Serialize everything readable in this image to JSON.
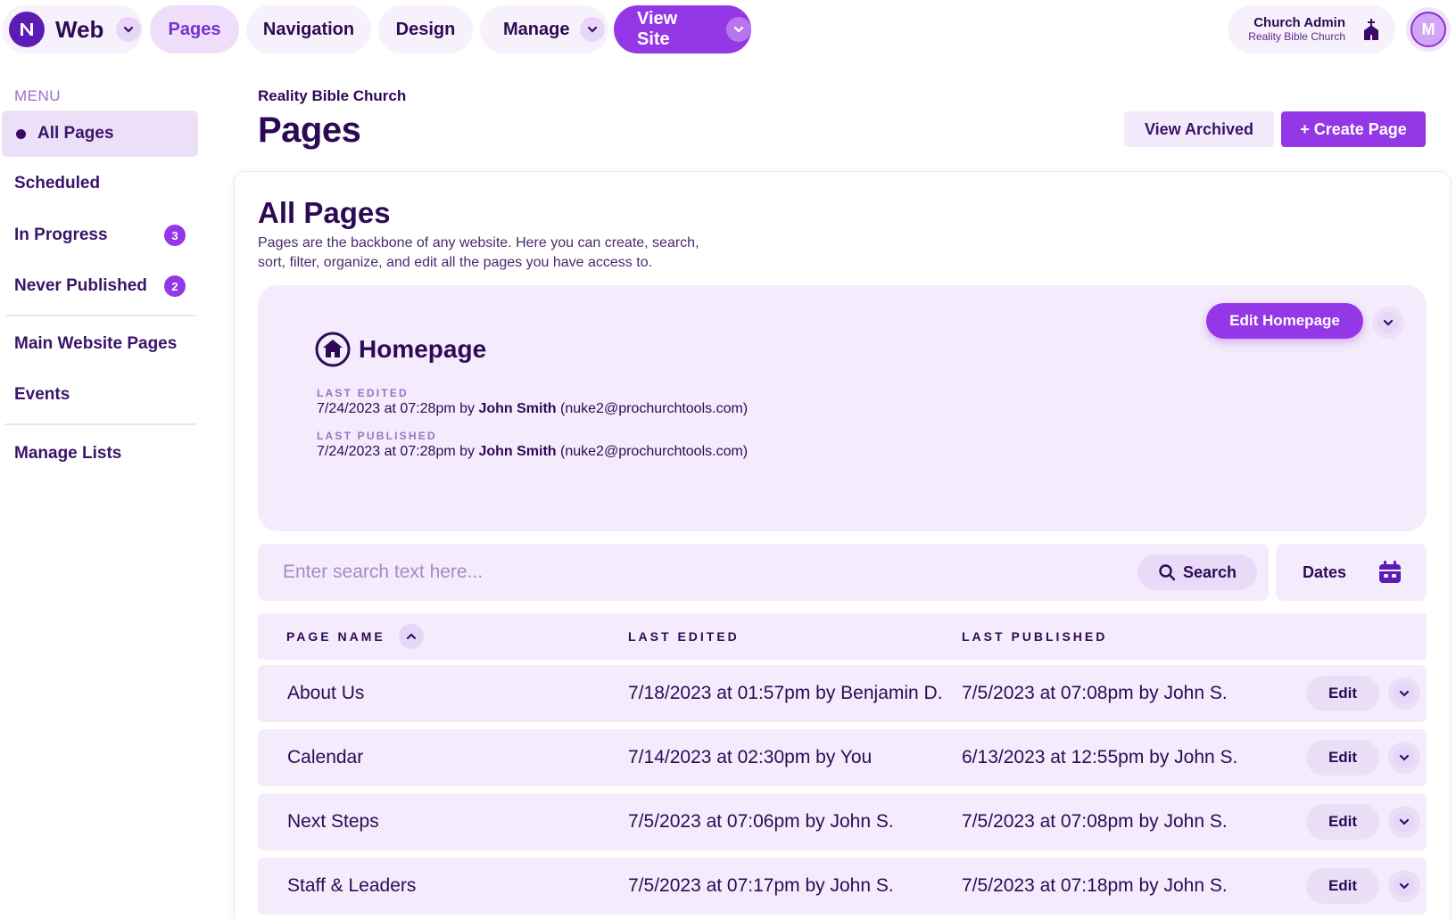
{
  "topbar": {
    "brand": "Web",
    "tabs": {
      "pages": "Pages",
      "navigation": "Navigation",
      "design": "Design",
      "manage": "Manage",
      "view_site": "View Site"
    },
    "account": {
      "name": "Church Admin",
      "org": "Reality Bible Church",
      "avatar_initial": "M"
    }
  },
  "sidebar": {
    "heading": "MENU",
    "items": {
      "all_pages": "All Pages",
      "scheduled": "Scheduled",
      "in_progress": "In Progress",
      "in_progress_count": "3",
      "never_published": "Never Published",
      "never_published_count": "2",
      "main_website_pages": "Main Website Pages",
      "events": "Events",
      "manage_lists": "Manage Lists"
    }
  },
  "header": {
    "org": "Reality Bible Church",
    "title": "Pages",
    "view_archived": "View Archived",
    "create_page": "+ Create Page"
  },
  "main": {
    "title": "All Pages",
    "description": "Pages are the backbone of any website. Here you can create, search, sort, filter, organize, and edit all the pages you have access to.",
    "homepage": {
      "title": "Homepage",
      "edit_button": "Edit Homepage",
      "last_edited_label": "LAST EDITED",
      "last_edited_prefix": "7/24/2023 at 07:28pm by ",
      "last_edited_user": "John Smith",
      "last_edited_email": " (nuke2@prochurchtools.com)",
      "last_published_label": "LAST PUBLISHED",
      "last_published_prefix": "7/24/2023 at 07:28pm by ",
      "last_published_user": "John Smith",
      "last_published_email": " (nuke2@prochurchtools.com)"
    },
    "search": {
      "placeholder": "Enter search text here...",
      "button": "Search",
      "dates": "Dates"
    },
    "table": {
      "headers": {
        "page_name": "PAGE NAME",
        "last_edited": "LAST EDITED",
        "last_published": "LAST PUBLISHED"
      },
      "edit_label": "Edit",
      "rows": [
        {
          "name": "About Us",
          "last_edited": "7/18/2023 at 01:57pm by Benjamin D.",
          "last_published": "7/5/2023 at 07:08pm by John S."
        },
        {
          "name": "Calendar",
          "last_edited": "7/14/2023 at 02:30pm by You",
          "last_published": "6/13/2023 at 12:55pm by John S."
        },
        {
          "name": "Next Steps",
          "last_edited": "7/5/2023 at 07:06pm by John S.",
          "last_published": "7/5/2023 at 07:08pm by John S."
        },
        {
          "name": "Staff & Leaders",
          "last_edited": "7/5/2023 at 07:17pm by John S.",
          "last_published": "7/5/2023 at 07:18pm by John S."
        }
      ]
    }
  },
  "colors": {
    "accent": "#9437e6",
    "text_dark": "#2d0a55",
    "panel": "#f4ecfc"
  }
}
